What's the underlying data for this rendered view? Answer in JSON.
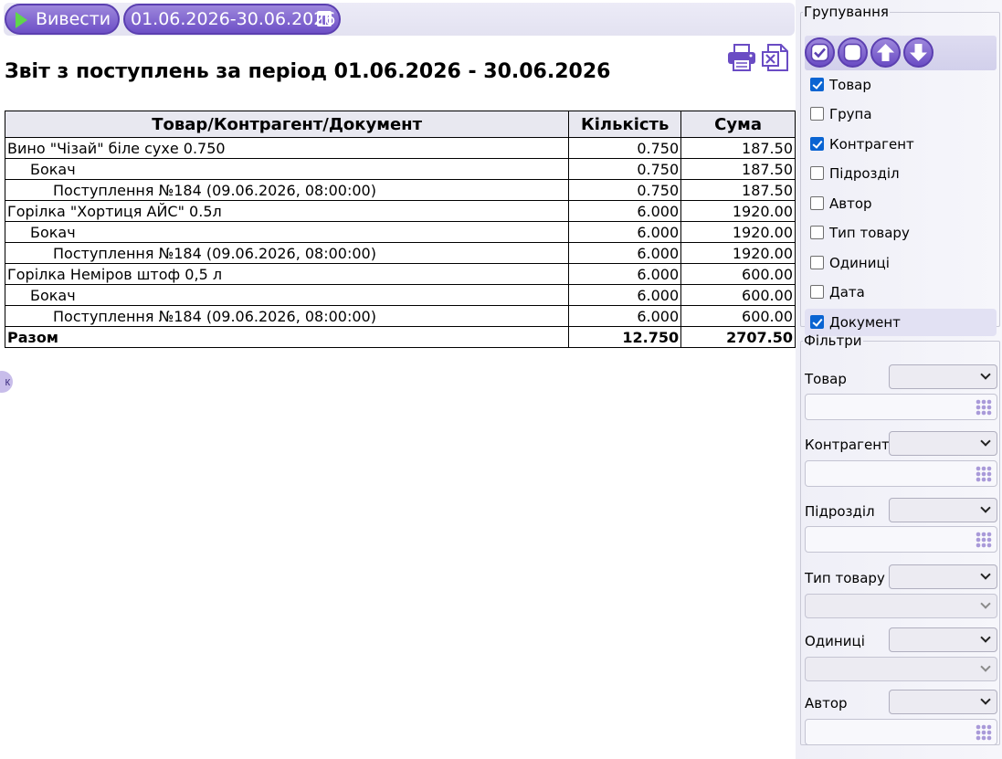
{
  "toolbar": {
    "run_label": "Вивести",
    "period_label": "01.06.2026-30.06.2026"
  },
  "report": {
    "title": "Звіт з поступлень за період 01.06.2026 - 30.06.2026",
    "columns": [
      "Товар/Контрагент/Документ",
      "Кількість",
      "Сума"
    ],
    "rows": [
      {
        "name": "Вино \"Чізай\" біле сухе 0.750",
        "qty": "0.750",
        "sum": "187.50"
      },
      {
        "name": "Бокач",
        "qty": "0.750",
        "sum": "187.50"
      },
      {
        "name": "Поступлення №184 (09.06.2026, 08:00:00)",
        "qty": "0.750",
        "sum": "187.50"
      },
      {
        "name": "Горілка \"Хортиця АЙС\" 0.5л",
        "qty": "6.000",
        "sum": "1920.00"
      },
      {
        "name": "Бокач",
        "qty": "6.000",
        "sum": "1920.00"
      },
      {
        "name": "Поступлення №184 (09.06.2026, 08:00:00)",
        "qty": "6.000",
        "sum": "1920.00"
      },
      {
        "name": "Горілка Неміров штоф 0,5 л",
        "qty": "6.000",
        "sum": "600.00"
      },
      {
        "name": "Бокач",
        "qty": "6.000",
        "sum": "600.00"
      },
      {
        "name": "Поступлення №184 (09.06.2026, 08:00:00)",
        "qty": "6.000",
        "sum": "600.00"
      }
    ],
    "total": {
      "name": "Разом",
      "qty": "12.750",
      "sum": "2707.50"
    }
  },
  "side_tab": "к",
  "grouping": {
    "legend": "Групування",
    "options": [
      {
        "label": "Товар",
        "checked": true
      },
      {
        "label": "Група",
        "checked": false
      },
      {
        "label": "Контрагент",
        "checked": true
      },
      {
        "label": "Підрозділ",
        "checked": false
      },
      {
        "label": "Автор",
        "checked": false
      },
      {
        "label": "Тип товару",
        "checked": false
      },
      {
        "label": "Одиниці",
        "checked": false
      },
      {
        "label": "Дата",
        "checked": false
      },
      {
        "label": "Документ",
        "checked": true
      }
    ]
  },
  "filters": {
    "legend": "Фільтри",
    "items": [
      {
        "label": "Товар"
      },
      {
        "label": "Контрагент"
      },
      {
        "label": "Підрозділ"
      },
      {
        "label": "Тип товару"
      },
      {
        "label": "Одиниці"
      },
      {
        "label": "Автор"
      }
    ]
  },
  "colors": {
    "accent": "#7a5fd0",
    "play": "#5fd64b",
    "checkbox": "#0a64d2"
  }
}
